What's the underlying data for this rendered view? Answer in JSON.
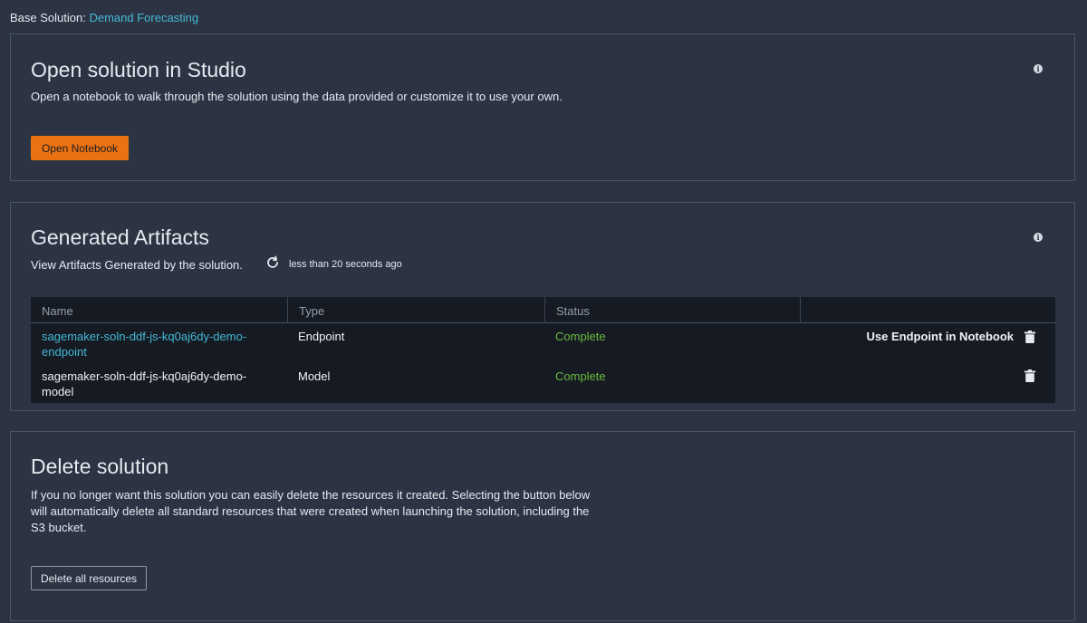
{
  "base_solution": {
    "label": "Base Solution:",
    "value": "Demand Forecasting"
  },
  "studio_card": {
    "title": "Open solution in Studio",
    "description": "Open a notebook to walk through the solution using the data provided or customize it to use your own.",
    "button": "Open Notebook",
    "info_icon": "info-icon"
  },
  "artifacts_card": {
    "title": "Generated Artifacts",
    "description": "View Artifacts Generated by the solution.",
    "refresh_time": "less than 20 seconds ago",
    "info_icon": "info-icon",
    "columns": [
      "Name",
      "Type",
      "Status",
      ""
    ],
    "rows": [
      {
        "name_line1": "sagemaker-soln-ddf-js-kq0aj6dy-demo-",
        "name_line2": "endpoint",
        "type": "Endpoint",
        "status": "Complete",
        "action": "Use Endpoint in Notebook"
      },
      {
        "name_line1": "sagemaker-soln-ddf-js-kq0aj6dy-demo-",
        "name_line2": "model",
        "type": "Model",
        "status": "Complete",
        "action": ""
      }
    ]
  },
  "delete_card": {
    "title": "Delete solution",
    "description_line1": "If you no longer want this solution you can easily delete the resources it created. Selecting the button below",
    "description_line2": "will automatically delete all standard resources that were created when launching the solution, including the",
    "description_line3": "S3 bucket.",
    "button": "Delete all resources"
  },
  "colors": {
    "background": "#2c3444",
    "accent_orange": "#ec7211",
    "link_blue": "#44b9d6",
    "status_green": "#6cbd3f",
    "table_bg": "#161a22"
  }
}
